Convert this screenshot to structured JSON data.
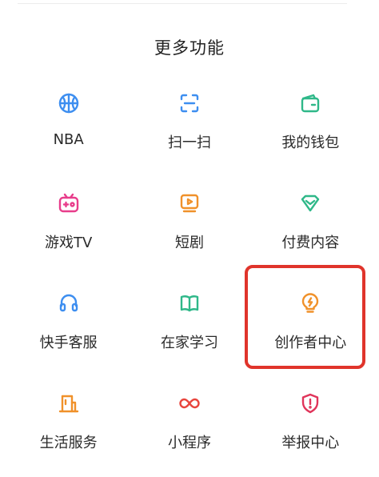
{
  "section": {
    "title": "更多功能"
  },
  "items": [
    {
      "label": "NBA",
      "icon": "basketball-icon",
      "color": "#3d8ef0"
    },
    {
      "label": "扫一扫",
      "icon": "scan-icon",
      "color": "#3d8ef0"
    },
    {
      "label": "我的钱包",
      "icon": "wallet-icon",
      "color": "#2fb889"
    },
    {
      "label": "游戏TV",
      "icon": "game-tv-icon",
      "color": "#e83d8b"
    },
    {
      "label": "短剧",
      "icon": "short-drama-icon",
      "color": "#f0912a"
    },
    {
      "label": "付费内容",
      "icon": "paid-content-icon",
      "color": "#2fb889"
    },
    {
      "label": "快手客服",
      "icon": "headset-icon",
      "color": "#3d8ef0"
    },
    {
      "label": "在家学习",
      "icon": "book-icon",
      "color": "#2fb889"
    },
    {
      "label": "创作者中心",
      "icon": "lightbulb-icon",
      "color": "#f0912a"
    },
    {
      "label": "生活服务",
      "icon": "storefront-icon",
      "color": "#f0912a"
    },
    {
      "label": "小程序",
      "icon": "mini-program-icon",
      "color": "#e8453d"
    },
    {
      "label": "举报中心",
      "icon": "shield-alert-icon",
      "color": "#e0345a"
    }
  ],
  "highlight": {
    "target": "创作者中心",
    "color": "#e0342b"
  }
}
